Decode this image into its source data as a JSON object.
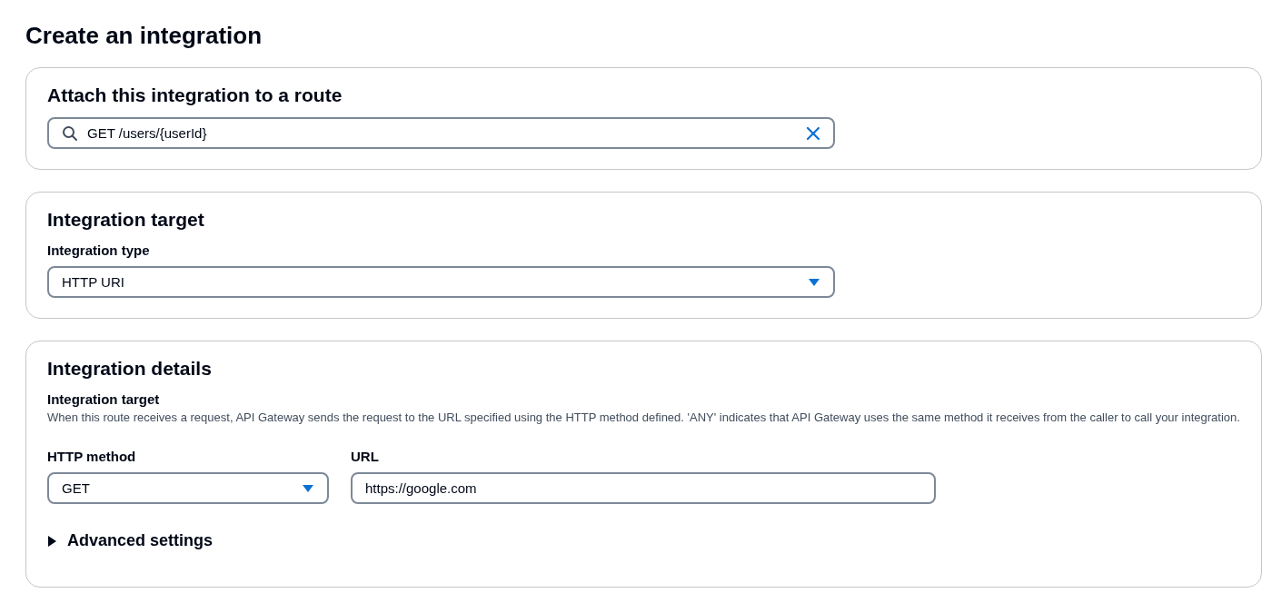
{
  "page": {
    "title": "Create an integration"
  },
  "route_section": {
    "title": "Attach this integration to a route",
    "search": {
      "value": "GET /users/{userId}"
    }
  },
  "target_section": {
    "title": "Integration target",
    "type_label": "Integration type",
    "type_select": {
      "value": "HTTP URI"
    }
  },
  "details_section": {
    "title": "Integration details",
    "subtitle": "Integration target",
    "description": "When this route receives a request, API Gateway sends the request to the URL specified using the HTTP method defined. 'ANY' indicates that API Gateway uses the same method it receives from the caller to call your integration.",
    "method": {
      "label": "HTTP method",
      "value": "GET"
    },
    "url": {
      "label": "URL",
      "value": "https://google.com"
    },
    "advanced": {
      "label": "Advanced settings",
      "expanded": false
    }
  }
}
